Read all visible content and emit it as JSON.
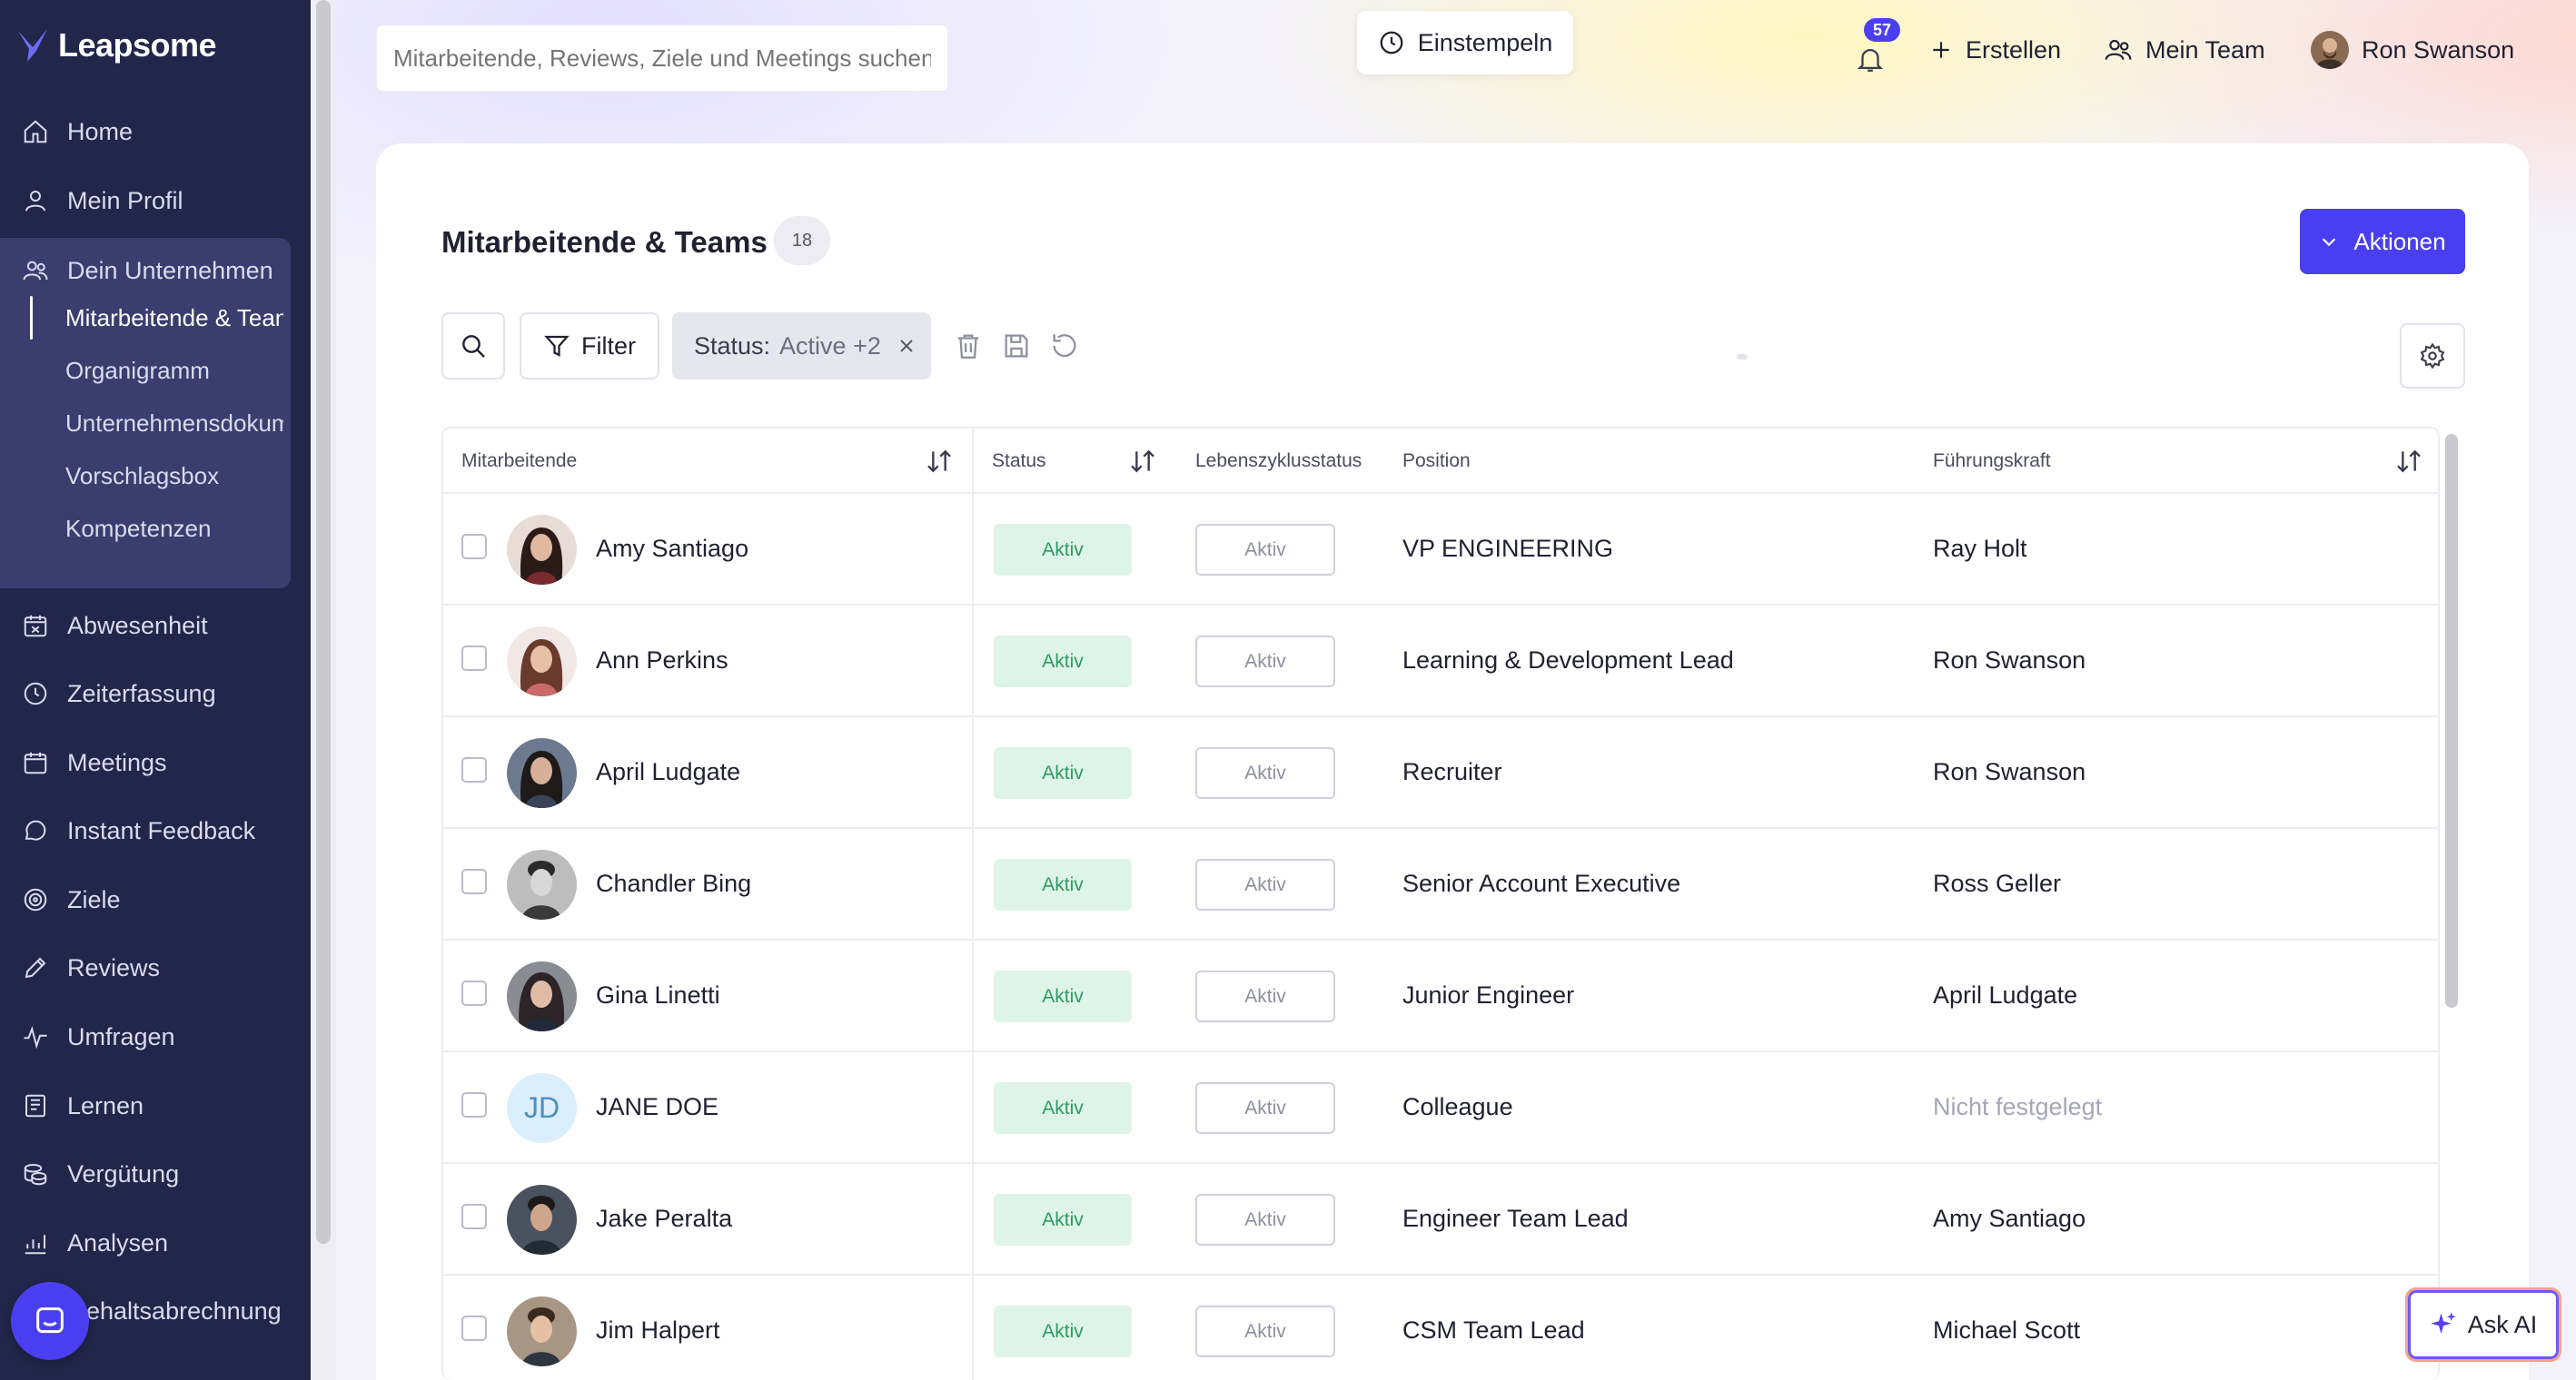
{
  "app": {
    "name": "Leapsome"
  },
  "sidebar": {
    "items": [
      {
        "label": "Home",
        "icon": "home-icon"
      },
      {
        "label": "Mein Profil",
        "icon": "user-icon"
      },
      {
        "label": "Dein Unternehmen",
        "icon": "users-icon"
      },
      {
        "label": "Abwesenheit",
        "icon": "calendar-x-icon"
      },
      {
        "label": "Zeiterfassung",
        "icon": "clock-icon"
      },
      {
        "label": "Meetings",
        "icon": "calendar-icon"
      },
      {
        "label": "Instant Feedback",
        "icon": "chat-icon"
      },
      {
        "label": "Ziele",
        "icon": "target-icon"
      },
      {
        "label": "Reviews",
        "icon": "pencil-icon"
      },
      {
        "label": "Umfragen",
        "icon": "pulse-icon"
      },
      {
        "label": "Lernen",
        "icon": "book-icon"
      },
      {
        "label": "Vergütung",
        "icon": "coins-icon"
      },
      {
        "label": "Analysen",
        "icon": "chart-icon"
      },
      {
        "label": "Gehaltsabrechnung",
        "icon": "payroll-icon"
      }
    ],
    "subitems": [
      {
        "label": "Mitarbeitende & Teams",
        "active": true
      },
      {
        "label": "Organigramm"
      },
      {
        "label": "Unternehmensdokumente"
      },
      {
        "label": "Vorschlagsbox"
      },
      {
        "label": "Kompetenzen"
      }
    ]
  },
  "topbar": {
    "search_placeholder": "Mitarbeitende, Reviews, Ziele und Meetings suchen",
    "clock_in_label": "Einstempeln",
    "notification_count": "57",
    "create_label": "Erstellen",
    "my_team_label": "Mein Team",
    "user_name": "Ron Swanson"
  },
  "page": {
    "title": "Mitarbeitende & Teams",
    "count": "18",
    "actions_label": "Aktionen",
    "filter_label": "Filter",
    "status_filter_key": "Status:",
    "status_filter_value": "Active +2"
  },
  "table": {
    "columns": {
      "employee": "Mitarbeitende",
      "status": "Status",
      "lifecycle": "Lebenszyklusstatus",
      "position": "Position",
      "manager": "Führungskraft"
    },
    "rows": [
      {
        "name": "Amy Santiago",
        "status": "Aktiv",
        "lifecycle": "Aktiv",
        "position": "VP ENGINEERING",
        "manager": "Ray Holt",
        "avatar_color": "#5a3a34"
      },
      {
        "name": "Ann Perkins",
        "status": "Aktiv",
        "lifecycle": "Aktiv",
        "position": "Learning & Development Lead",
        "manager": "Ron Swanson",
        "avatar_color": "#7a4a3a"
      },
      {
        "name": "April Ludgate",
        "status": "Aktiv",
        "lifecycle": "Aktiv",
        "position": "Recruiter",
        "manager": "Ron Swanson",
        "avatar_color": "#3b4456"
      },
      {
        "name": "Chandler Bing",
        "status": "Aktiv",
        "lifecycle": "Aktiv",
        "position": "Senior Account Executive",
        "manager": "Ross Geller",
        "avatar_color": "#4a4a4a"
      },
      {
        "name": "Gina Linetti",
        "status": "Aktiv",
        "lifecycle": "Aktiv",
        "position": "Junior Engineer",
        "manager": "April Ludgate",
        "avatar_color": "#3e3a3c"
      },
      {
        "name": "JANE DOE",
        "initials": "JD",
        "status": "Aktiv",
        "lifecycle": "Aktiv",
        "position": "Colleague",
        "manager": "Nicht festgelegt",
        "manager_muted": true
      },
      {
        "name": "Jake Peralta",
        "status": "Aktiv",
        "lifecycle": "Aktiv",
        "position": "Engineer Team Lead",
        "manager": "Amy Santiago",
        "avatar_color": "#2f3642"
      },
      {
        "name": "Jim Halpert",
        "status": "Aktiv",
        "lifecycle": "Aktiv",
        "position": "CSM Team Lead",
        "manager": "Michael Scott",
        "avatar_color": "#5a4a3e"
      }
    ]
  },
  "ask_ai_label": "Ask AI",
  "colors": {
    "sidebar": "#22264a",
    "accent": "#4a3ff0",
    "active_pill": "#dff4e8",
    "active_text": "#2e9a62"
  }
}
